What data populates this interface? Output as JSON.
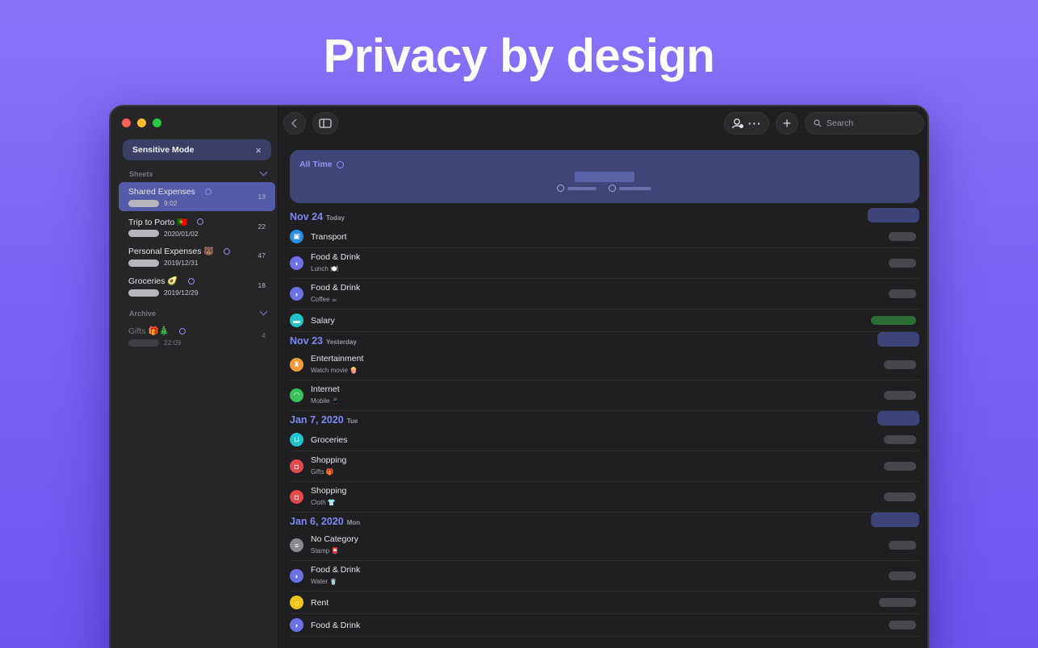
{
  "headline": "Privacy by design",
  "sidebar": {
    "sensitive_mode": {
      "label": "Sensitive Mode",
      "close_icon": "×"
    },
    "sheets_label": "Sheets",
    "archive_label": "Archive",
    "sheets": [
      {
        "name": "Shared Expenses",
        "date": "9:02",
        "count": "13",
        "active": true
      },
      {
        "name": "Trip to Porto 🇵🇹",
        "date": "2020/01/02",
        "count": "22"
      },
      {
        "name": "Personal Expenses 🐻",
        "date": "2019/12/31",
        "count": "47"
      },
      {
        "name": "Groceries 🥑",
        "date": "2019/12/29",
        "count": "18"
      }
    ],
    "archive": [
      {
        "name": "Gifts 🎁🎄",
        "date": "22:09",
        "count": "4"
      }
    ]
  },
  "toolbar": {
    "search_placeholder": "Search",
    "more_label": "···",
    "add_label": "+"
  },
  "summary": {
    "period_label": "All Time"
  },
  "days": [
    {
      "date": "Nov 24",
      "weekday": "Today",
      "entries": [
        {
          "title": "Transport",
          "note": "",
          "icon": "bus-icon",
          "color": "#2b8fe0"
        },
        {
          "title": "Food & Drink",
          "note": "Lunch 🍽️",
          "icon": "food-icon",
          "color": "#6e70e6"
        },
        {
          "title": "Food & Drink",
          "note": "Coffee ☕",
          "icon": "food-icon",
          "color": "#6e70e6"
        },
        {
          "title": "Salary",
          "note": "",
          "icon": "money-icon",
          "color": "#22c2c8",
          "income": true
        }
      ]
    },
    {
      "date": "Nov 23",
      "weekday": "Yesterday",
      "entries": [
        {
          "title": "Entertainment",
          "note": "Watch movie 🍿",
          "icon": "ticket-icon",
          "color": "#f39a3a"
        },
        {
          "title": "Internet",
          "note": "Mobile 📱",
          "icon": "wifi-icon",
          "color": "#3ac25a"
        }
      ]
    },
    {
      "date": "Jan 7, 2020",
      "weekday": "Tue",
      "entries": [
        {
          "title": "Groceries",
          "note": "",
          "icon": "cart-icon",
          "color": "#22c2c8"
        },
        {
          "title": "Shopping",
          "note": "Gifts 🎁",
          "icon": "gift-icon",
          "color": "#e5484d"
        },
        {
          "title": "Shopping",
          "note": "Cloth 👕",
          "icon": "gift-icon",
          "color": "#e5484d"
        }
      ]
    },
    {
      "date": "Jan 6, 2020",
      "weekday": "Mon",
      "entries": [
        {
          "title": "No Category",
          "note": "Stamp 📮",
          "icon": "list-icon",
          "color": "#8a8a8e"
        },
        {
          "title": "Food & Drink",
          "note": "Water 🥤",
          "icon": "food-icon",
          "color": "#6e70e6"
        },
        {
          "title": "Rent",
          "note": "",
          "icon": "house-icon",
          "color": "#f2c21a"
        },
        {
          "title": "Food & Drink",
          "note": "",
          "icon": "food-icon",
          "color": "#6e70e6"
        }
      ]
    }
  ]
}
